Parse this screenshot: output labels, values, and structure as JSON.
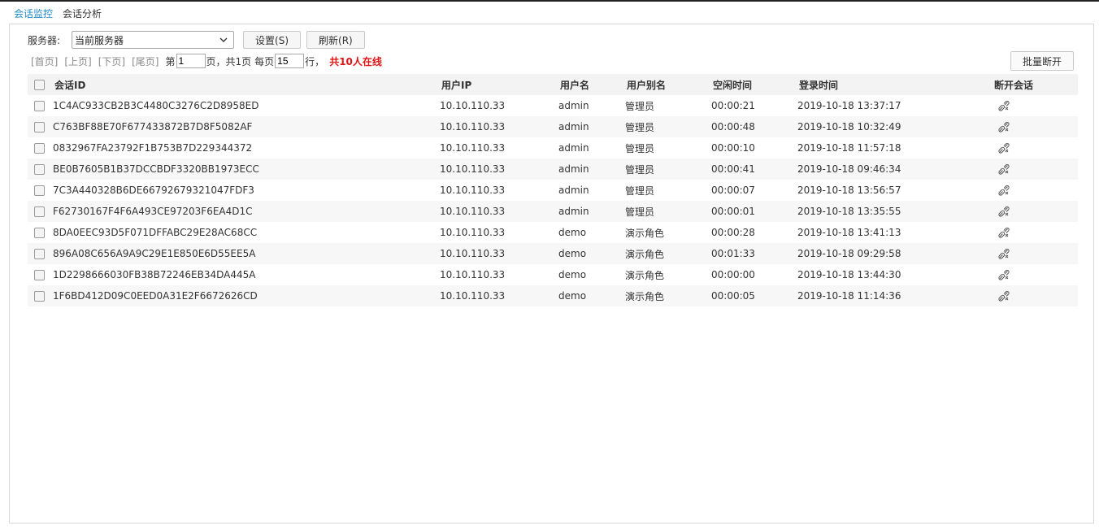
{
  "tabs": [
    {
      "label": "会话监控",
      "active": true
    },
    {
      "label": "会话分析",
      "active": false
    }
  ],
  "toolbar": {
    "server_label": "服务器:",
    "server_value": "当前服务器",
    "settings_label": "设置(S)",
    "refresh_label": "刷新(R)",
    "batch_disconnect_label": "批量断开"
  },
  "pager": {
    "first": "[首页]",
    "prev": "[上页]",
    "next": "[下页]",
    "last": "[尾页]",
    "page_prefix": "第",
    "page_value": "1",
    "page_suffix": "页，共1页",
    "per_page_prefix": "每页",
    "per_page_value": "15",
    "per_page_suffix": "行，",
    "online_text": "共10人在线"
  },
  "table": {
    "headers": {
      "session_id": "会话ID",
      "user_ip": "用户IP",
      "username": "用户名",
      "alias": "用户别名",
      "idle_time": "空闲时间",
      "login_time": "登录时间",
      "disconnect": "断开会话"
    },
    "rows": [
      {
        "session_id": "1C4AC933CB2B3C4480C3276C2D8958ED",
        "user_ip": "10.10.110.33",
        "username": "admin",
        "alias": "管理员",
        "idle_time": "00:00:21",
        "login_time": "2019-10-18 13:37:17"
      },
      {
        "session_id": "C763BF88E70F677433872B7D8F5082AF",
        "user_ip": "10.10.110.33",
        "username": "admin",
        "alias": "管理员",
        "idle_time": "00:00:48",
        "login_time": "2019-10-18 10:32:49"
      },
      {
        "session_id": "0832967FA23792F1B753B7D229344372",
        "user_ip": "10.10.110.33",
        "username": "admin",
        "alias": "管理员",
        "idle_time": "00:00:10",
        "login_time": "2019-10-18 11:57:18"
      },
      {
        "session_id": "BE0B7605B1B37DCCBDF3320BB1973ECC",
        "user_ip": "10.10.110.33",
        "username": "admin",
        "alias": "管理员",
        "idle_time": "00:00:41",
        "login_time": "2019-10-18 09:46:34"
      },
      {
        "session_id": "7C3A440328B6DE66792679321047FDF3",
        "user_ip": "10.10.110.33",
        "username": "admin",
        "alias": "管理员",
        "idle_time": "00:00:07",
        "login_time": "2019-10-18 13:56:57"
      },
      {
        "session_id": "F62730167F4F6A493CE97203F6EA4D1C",
        "user_ip": "10.10.110.33",
        "username": "admin",
        "alias": "管理员",
        "idle_time": "00:00:01",
        "login_time": "2019-10-18 13:35:55"
      },
      {
        "session_id": "8DA0EEC93D5F071DFFABC29E28AC68CC",
        "user_ip": "10.10.110.33",
        "username": "demo",
        "alias": "演示角色",
        "idle_time": "00:00:28",
        "login_time": "2019-10-18 13:41:13"
      },
      {
        "session_id": "896A08C656A9A9C29E1E850E6D55EE5A",
        "user_ip": "10.10.110.33",
        "username": "demo",
        "alias": "演示角色",
        "idle_time": "00:01:33",
        "login_time": "2019-10-18 09:29:58"
      },
      {
        "session_id": "1D2298666030FB38B72246EB34DA445A",
        "user_ip": "10.10.110.33",
        "username": "demo",
        "alias": "演示角色",
        "idle_time": "00:00:00",
        "login_time": "2019-10-18 13:44:30"
      },
      {
        "session_id": "1F6BD412D09C0EED0A31E2F6672626CD",
        "user_ip": "10.10.110.33",
        "username": "demo",
        "alias": "演示角色",
        "idle_time": "00:00:05",
        "login_time": "2019-10-18 11:14:36"
      }
    ]
  },
  "icons": {
    "dropdown": "chevron-down-icon",
    "disconnect": "disconnect-icon",
    "checkbox": "checkbox-icon"
  },
  "colors": {
    "accent": "#1e88c8",
    "online_text": "#e01515",
    "header_bg": "#f3f3f3",
    "alt_row_bg": "#f7f7f7"
  }
}
